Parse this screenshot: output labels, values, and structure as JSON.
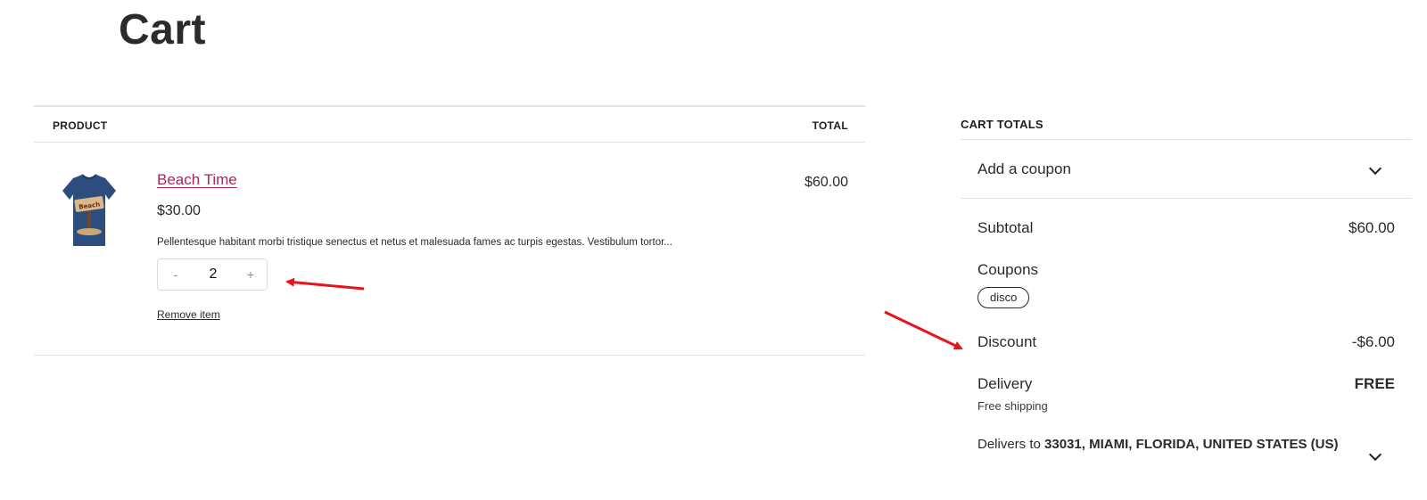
{
  "page": {
    "title": "Cart"
  },
  "cart": {
    "headers": {
      "product": "PRODUCT",
      "total": "TOTAL"
    },
    "items": [
      {
        "name": "Beach Time",
        "unit_price": "$30.00",
        "description": "Pellentesque habitant morbi tristique senectus et netus et malesuada fames ac turpis egestas. Vestibulum tortor...",
        "quantity": "2",
        "minus_label": "-",
        "plus_label": "+",
        "line_total": "$60.00",
        "remove_label": "Remove item",
        "image_text": "Beach"
      }
    ]
  },
  "totals": {
    "heading": "CART TOTALS",
    "coupon_toggle_label": "Add a coupon",
    "subtotal_label": "Subtotal",
    "subtotal_value": "$60.00",
    "coupons_label": "Coupons",
    "coupon_code": "disco",
    "discount_label": "Discount",
    "discount_value": "-$6.00",
    "delivery_label": "Delivery",
    "delivery_value": "FREE",
    "delivery_method": "Free shipping",
    "delivers_to_prefix": "Delivers to",
    "delivers_to_address": "33031, MIAMI, FLORIDA, UNITED STATES (US)"
  },
  "colors": {
    "link_accent": "#a8275d",
    "annotation_arrow": "#e8141b",
    "shirt_navy": "#2c4d7e"
  },
  "icons": [
    "chevron-down-icon",
    "annotation-arrow"
  ]
}
